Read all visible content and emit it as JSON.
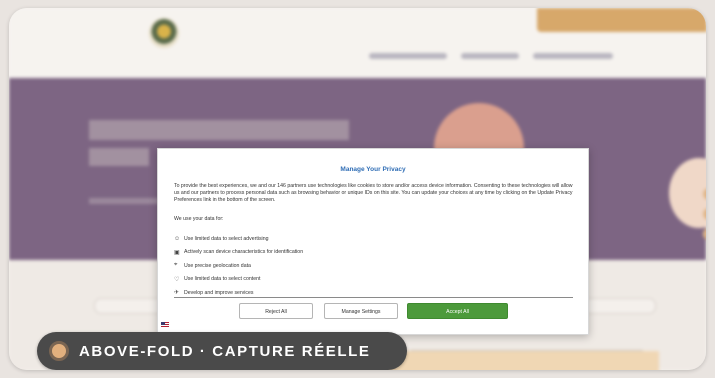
{
  "modal": {
    "title": "Manage Your Privacy",
    "intro": "To provide the best experiences, we and our 146 partners use technologies like cookies to store and/or access device information. Consenting to these technologies will allow us and our partners to process personal data such as browsing behavior or unique IDs on this site. You can update your choices at any time by clicking on the Update Privacy Preferences link in the bottom of the screen.",
    "use_label": "We use your data for:",
    "purposes": [
      {
        "icon": "person-icon",
        "glyph": "☺",
        "label": "Use limited data to select advertising"
      },
      {
        "icon": "device-icon",
        "glyph": "▣",
        "label": "Actively scan device characteristics for identification"
      },
      {
        "icon": "location-pin-icon",
        "glyph": "⌖",
        "label": "Use precise geolocation data"
      },
      {
        "icon": "heart-icon",
        "glyph": "♡",
        "label": "Use limited data to select content"
      },
      {
        "icon": "rocket-icon",
        "glyph": "✈",
        "label": "Develop and improve services"
      }
    ],
    "buttons": {
      "reject": "Reject All",
      "manage": "Manage Settings",
      "accept": "Accept All"
    },
    "flag_icon": "us-flag-icon"
  },
  "badge": {
    "text": "ABOVE-FOLD · CAPTURE RÉELLE"
  },
  "colors": {
    "accent": "#2f6db5",
    "accept": "#4c9a3b",
    "hero": "#7d6583"
  }
}
